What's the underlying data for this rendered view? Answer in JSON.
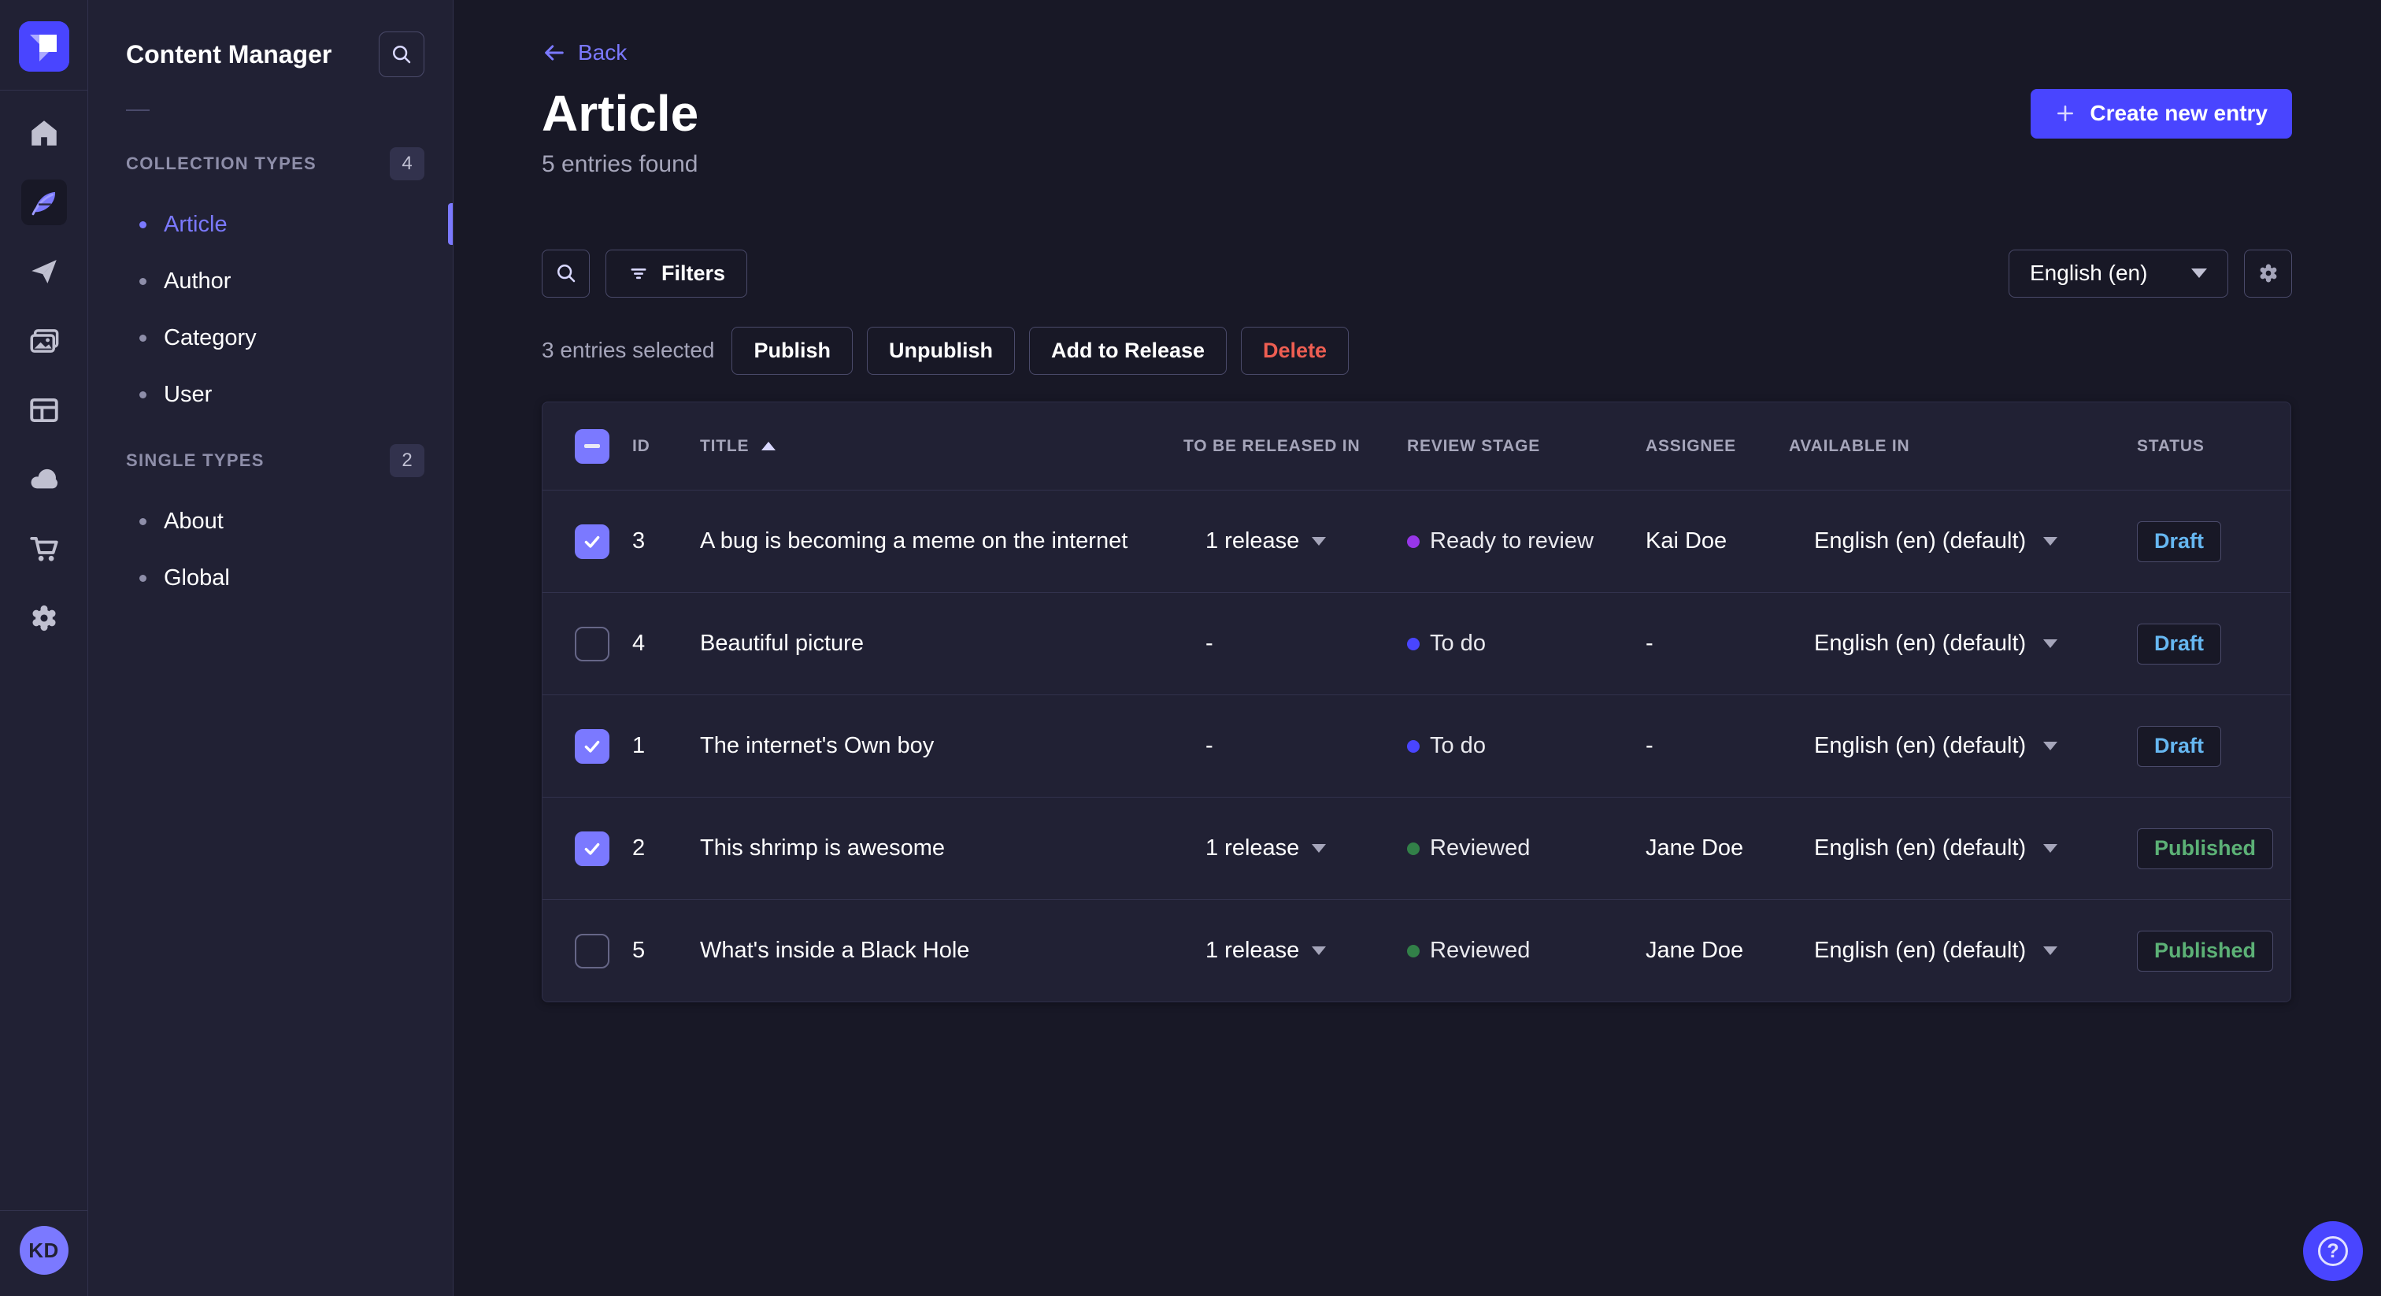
{
  "nav_rail": {
    "items": [
      {
        "icon": "home-icon",
        "active": false
      },
      {
        "icon": "feather-content-manager-icon",
        "active": true
      },
      {
        "icon": "paper-plane-icon",
        "active": false
      },
      {
        "icon": "media-library-icon",
        "active": false
      },
      {
        "icon": "layout-builder-icon",
        "active": false
      },
      {
        "icon": "cloud-icon",
        "active": false
      },
      {
        "icon": "cart-marketplace-icon",
        "active": false
      },
      {
        "icon": "gear-settings-icon",
        "active": false
      }
    ],
    "avatar_initials": "KD"
  },
  "sidebar": {
    "title": "Content Manager",
    "sections": [
      {
        "label": "COLLECTION TYPES",
        "count": "4",
        "items": [
          {
            "label": "Article",
            "active": true
          },
          {
            "label": "Author",
            "active": false
          },
          {
            "label": "Category",
            "active": false
          },
          {
            "label": "User",
            "active": false
          }
        ]
      },
      {
        "label": "SINGLE TYPES",
        "count": "2",
        "items": [
          {
            "label": "About",
            "active": false
          },
          {
            "label": "Global",
            "active": false
          }
        ]
      }
    ]
  },
  "header": {
    "back_label": "Back",
    "title": "Article",
    "subtitle": "5 entries found",
    "create_button_label": "Create new entry"
  },
  "toolbar": {
    "filters_label": "Filters",
    "locale_selected": "English (en)"
  },
  "selection": {
    "text": "3 entries selected",
    "publish_label": "Publish",
    "unpublish_label": "Unpublish",
    "add_to_release_label": "Add to Release",
    "delete_label": "Delete"
  },
  "table": {
    "select_all_state": "indeterminate",
    "columns": [
      "ID",
      "TITLE",
      "TO BE RELEASED IN",
      "REVIEW STAGE",
      "ASSIGNEE",
      "AVAILABLE IN",
      "STATUS"
    ],
    "rows": [
      {
        "checked": true,
        "id": "3",
        "title": "A bug is becoming a meme on the internet",
        "release": "1 release",
        "release_expandable": true,
        "review_stage": "Ready to review",
        "review_color": "#9736e8",
        "assignee": "Kai Doe",
        "available_in": "English (en) (default)",
        "status": "Draft"
      },
      {
        "checked": false,
        "id": "4",
        "title": "Beautiful picture",
        "release": "-",
        "release_expandable": false,
        "review_stage": "To do",
        "review_color": "#4945ff",
        "assignee": "-",
        "available_in": "English (en) (default)",
        "status": "Draft"
      },
      {
        "checked": true,
        "id": "1",
        "title": "The internet's Own boy",
        "release": "-",
        "release_expandable": false,
        "review_stage": "To do",
        "review_color": "#4945ff",
        "assignee": "-",
        "available_in": "English (en) (default)",
        "status": "Draft"
      },
      {
        "checked": true,
        "id": "2",
        "title": "This shrimp is awesome",
        "release": "1 release",
        "release_expandable": true,
        "review_stage": "Reviewed",
        "review_color": "#328048",
        "assignee": "Jane Doe",
        "available_in": "English (en) (default)",
        "status": "Published"
      },
      {
        "checked": false,
        "id": "5",
        "title": "What's inside a Black Hole",
        "release": "1 release",
        "release_expandable": true,
        "review_stage": "Reviewed",
        "review_color": "#328048",
        "assignee": "Jane Doe",
        "available_in": "English (en) (default)",
        "status": "Published"
      }
    ]
  },
  "help": {
    "icon_glyph": "?"
  },
  "colors": {
    "background": "#181826",
    "surface": "#212134",
    "border": "#32324d",
    "accent": "#4945ff",
    "accent_light": "#7b79ff",
    "draft_text": "#66b7f1",
    "published_text": "#5cb176",
    "danger_text": "#ee5e52"
  }
}
